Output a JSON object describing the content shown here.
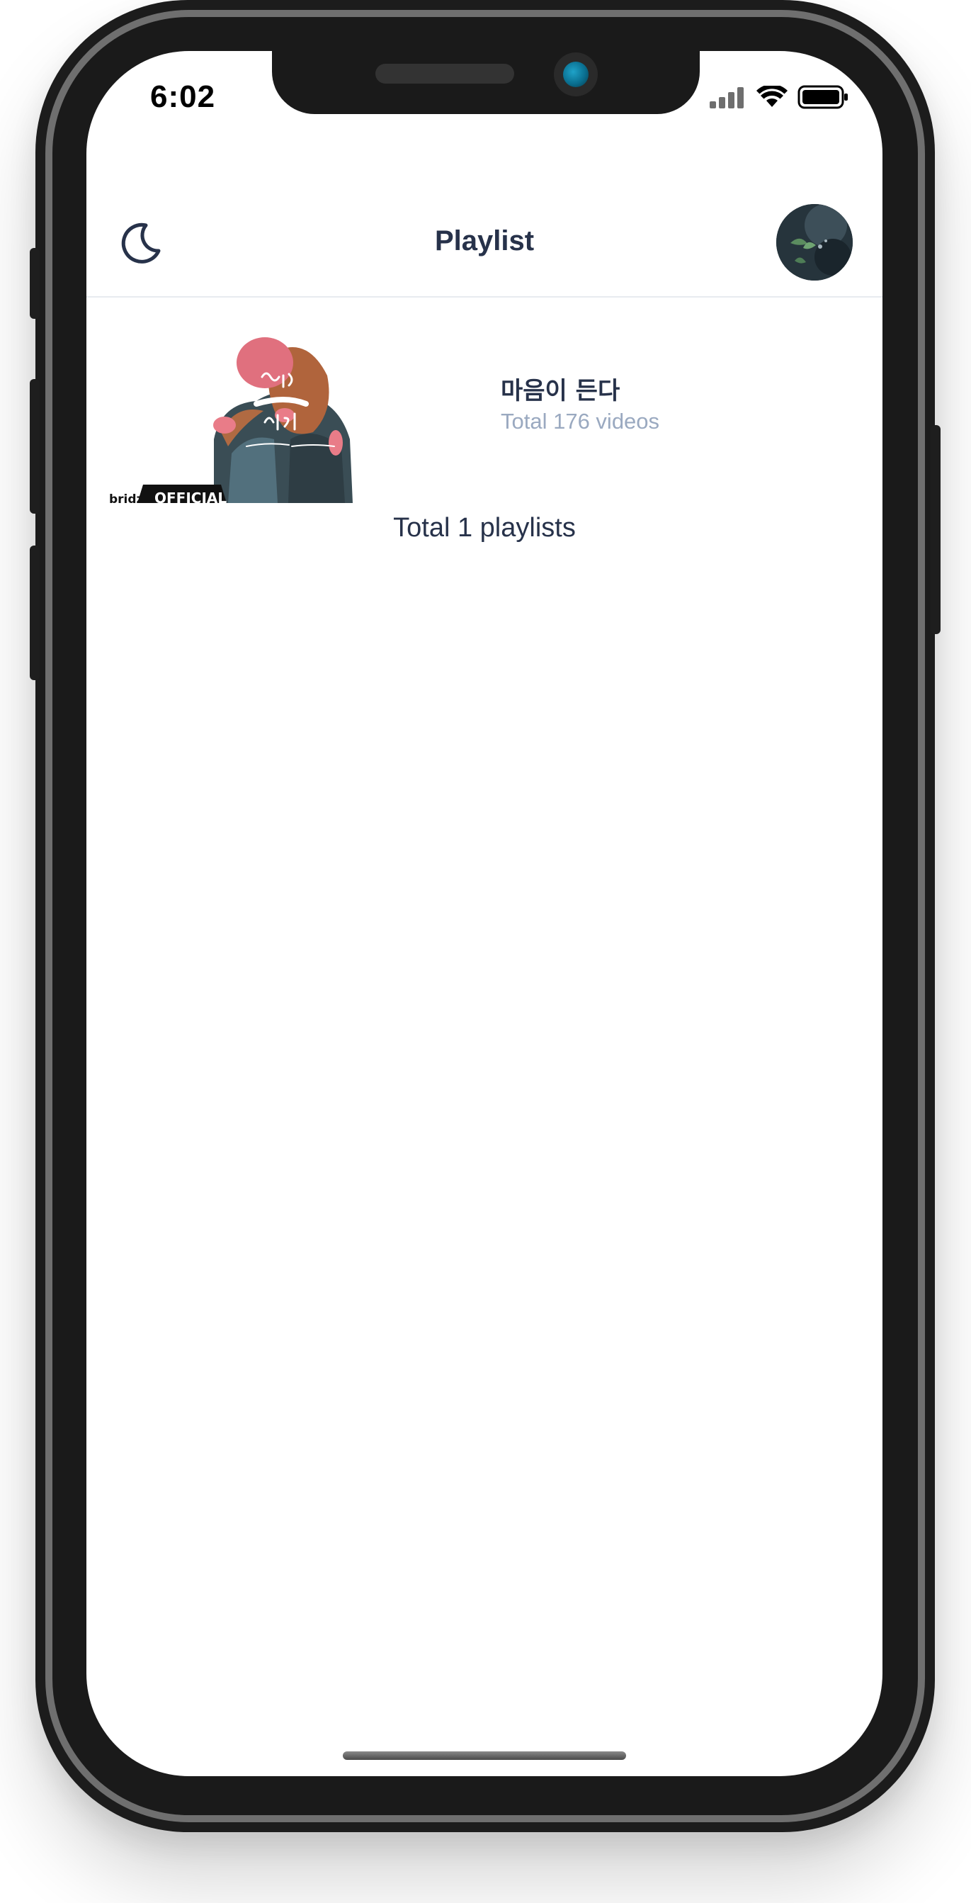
{
  "status_bar": {
    "time": "6:02"
  },
  "header": {
    "title": "Playlist",
    "theme_icon": "moon-icon",
    "avatar_icon": "avatar-image"
  },
  "playlists": [
    {
      "name": "마음이 든다",
      "count_text": "Total 176 videos",
      "thumbnail_text": {
        "badge": "OFFICIAL",
        "brand": "bridz"
      }
    }
  ],
  "footer": {
    "total_text": "Total 1 playlists"
  },
  "colors": {
    "title": "#27324a",
    "subtitle": "#9aa9c0",
    "divider": "#e8ebef",
    "frame": "#1c1c1c"
  }
}
